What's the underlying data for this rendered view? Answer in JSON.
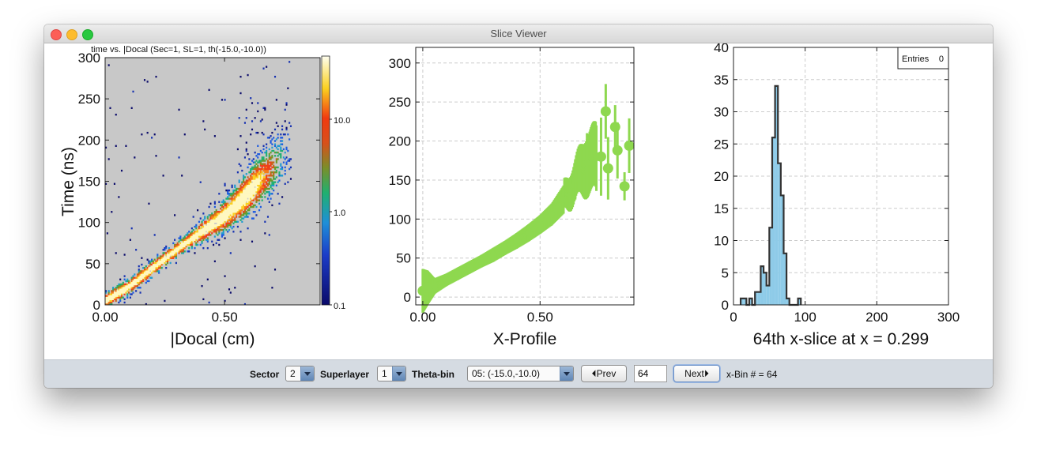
{
  "window": {
    "title": "Slice Viewer"
  },
  "colors": {
    "heat_background": "#c8c8c8",
    "profile": "#8ed84f",
    "hist_fill": "#8ecbe8",
    "hist_line": "#333333",
    "toolbar_bg": "#d5dbe2"
  },
  "chart_data": [
    {
      "type": "heatmap",
      "title": "time vs. |Docal (Sec=1, SL=1, th(-15.0,-10.0))",
      "xlabel": "|Docal (cm)",
      "ylabel": "Time (ns)",
      "xlim": [
        0,
        0.9
      ],
      "ylim": [
        0,
        300
      ],
      "xticks": [
        "0.00",
        "0.50"
      ],
      "yticks": [
        "0",
        "50",
        "100",
        "150",
        "200",
        "250",
        "300"
      ],
      "color_scale": "log",
      "colorbar_ticks": [
        "10.0",
        "1.0",
        "0.1"
      ],
      "ridge": {
        "x": [
          0.0,
          0.1,
          0.2,
          0.3,
          0.4,
          0.5,
          0.6,
          0.65
        ],
        "y": [
          5,
          22,
          45,
          67,
          88,
          108,
          135,
          150
        ]
      }
    },
    {
      "type": "scatter",
      "title": "",
      "xlabel": "X-Profile",
      "ylabel": "",
      "xlim": [
        -0.03,
        0.9
      ],
      "ylim": [
        -10,
        320
      ],
      "xticks": [
        "0.00",
        "0.50"
      ],
      "yticks": [
        "0",
        "50",
        "100",
        "150",
        "200",
        "250",
        "300"
      ],
      "grid": true,
      "points": [
        {
          "x": 0.0,
          "y": 8,
          "err": 28
        },
        {
          "x": 0.02,
          "y": 12,
          "err": 22
        },
        {
          "x": 0.05,
          "y": 14,
          "err": 10
        },
        {
          "x": 0.1,
          "y": 22,
          "err": 8
        },
        {
          "x": 0.15,
          "y": 30,
          "err": 8
        },
        {
          "x": 0.2,
          "y": 38,
          "err": 8
        },
        {
          "x": 0.25,
          "y": 46,
          "err": 8
        },
        {
          "x": 0.3,
          "y": 54,
          "err": 9
        },
        {
          "x": 0.35,
          "y": 63,
          "err": 9
        },
        {
          "x": 0.4,
          "y": 72,
          "err": 10
        },
        {
          "x": 0.45,
          "y": 82,
          "err": 11
        },
        {
          "x": 0.5,
          "y": 93,
          "err": 12
        },
        {
          "x": 0.55,
          "y": 106,
          "err": 14
        },
        {
          "x": 0.6,
          "y": 125,
          "err": 18
        },
        {
          "x": 0.65,
          "y": 150,
          "err": 25
        },
        {
          "x": 0.7,
          "y": 172,
          "err": 38
        },
        {
          "x": 0.74,
          "y": 178,
          "err": 42
        },
        {
          "x": 0.76,
          "y": 180,
          "err": 50
        },
        {
          "x": 0.78,
          "y": 238,
          "err": 35
        },
        {
          "x": 0.79,
          "y": 165,
          "err": 40
        },
        {
          "x": 0.82,
          "y": 218,
          "err": 28
        },
        {
          "x": 0.83,
          "y": 188,
          "err": 36
        },
        {
          "x": 0.86,
          "y": 142,
          "err": 18
        },
        {
          "x": 0.88,
          "y": 194,
          "err": 35
        }
      ]
    },
    {
      "type": "bar",
      "title": "",
      "xlabel": "64th x-slice at x = 0.299",
      "ylabel": "",
      "xlim": [
        0,
        300
      ],
      "ylim": [
        0,
        40
      ],
      "xticks": [
        "0",
        "100",
        "200",
        "300"
      ],
      "yticks": [
        "0",
        "5",
        "10",
        "15",
        "20",
        "25",
        "30",
        "35",
        "40"
      ],
      "grid": true,
      "legend": {
        "label": "Entries",
        "value": "0",
        "position": "top-right"
      },
      "bin_width": 4,
      "bins": [
        {
          "x": 12,
          "y": 1
        },
        {
          "x": 16,
          "y": 1
        },
        {
          "x": 20,
          "y": 0
        },
        {
          "x": 24,
          "y": 1
        },
        {
          "x": 28,
          "y": 0
        },
        {
          "x": 32,
          "y": 2
        },
        {
          "x": 36,
          "y": 2
        },
        {
          "x": 40,
          "y": 6
        },
        {
          "x": 44,
          "y": 5
        },
        {
          "x": 48,
          "y": 3
        },
        {
          "x": 52,
          "y": 12
        },
        {
          "x": 56,
          "y": 26
        },
        {
          "x": 60,
          "y": 34
        },
        {
          "x": 64,
          "y": 22
        },
        {
          "x": 68,
          "y": 17
        },
        {
          "x": 72,
          "y": 8
        },
        {
          "x": 76,
          "y": 1
        },
        {
          "x": 80,
          "y": 0
        },
        {
          "x": 84,
          "y": 0
        },
        {
          "x": 88,
          "y": 0
        },
        {
          "x": 92,
          "y": 1
        }
      ]
    }
  ],
  "controls": {
    "sector": {
      "label": "Sector",
      "value": "2"
    },
    "superlayer": {
      "label": "Superlayer",
      "value": "1"
    },
    "theta_bin": {
      "label": "Theta-bin",
      "value": "05: (-15.0,-10.0)"
    },
    "prev_label": "⏴Prev",
    "bin_value": "64",
    "next_label": "Next⏵",
    "status": "x-Bin # = 64"
  }
}
